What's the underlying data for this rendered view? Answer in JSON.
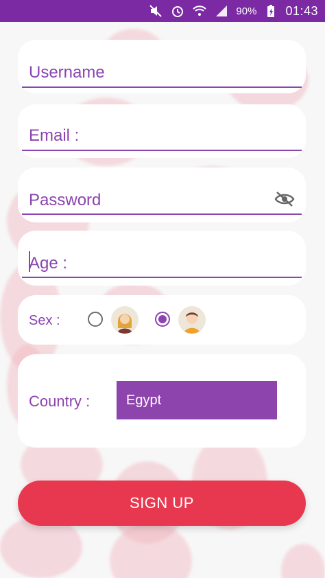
{
  "status_bar": {
    "battery_percent": "90%",
    "time": "01:43",
    "icons": [
      "mute-icon",
      "alarm-icon",
      "wifi-icon",
      "signal-icon",
      "battery-charging-icon"
    ]
  },
  "form": {
    "username": {
      "placeholder": "Username",
      "value": ""
    },
    "email": {
      "placeholder": "Email :",
      "value": ""
    },
    "password": {
      "placeholder": "Password",
      "value": "",
      "toggle_icon": "eye-off-icon"
    },
    "age": {
      "placeholder": "Age :",
      "value": ""
    },
    "sex": {
      "label": "Sex :",
      "options": [
        {
          "icon": "female-avatar-icon",
          "selected": false
        },
        {
          "icon": "male-avatar-icon",
          "selected": true
        }
      ]
    },
    "country": {
      "label": "Country :",
      "selected": "Egypt"
    }
  },
  "actions": {
    "signup_label": "SIGN UP"
  },
  "colors": {
    "status_bar": "#7b2aa3",
    "accent": "#8b44b0",
    "select_bg": "#8e44ad",
    "button": "#e8384f"
  }
}
